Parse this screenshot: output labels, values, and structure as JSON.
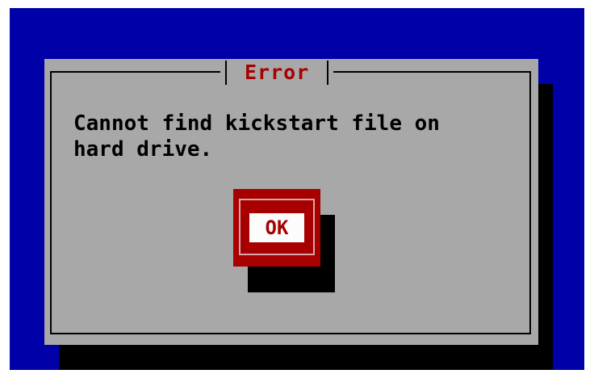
{
  "colors": {
    "background": "#0000a8",
    "dialog": "#a8a8a8",
    "shadow": "#000000",
    "accent": "#a80000",
    "button_face": "#fcfcfc"
  },
  "dialog": {
    "title": "Error",
    "message": "Cannot find kickstart file on\nhard drive.",
    "ok_label": "OK"
  }
}
